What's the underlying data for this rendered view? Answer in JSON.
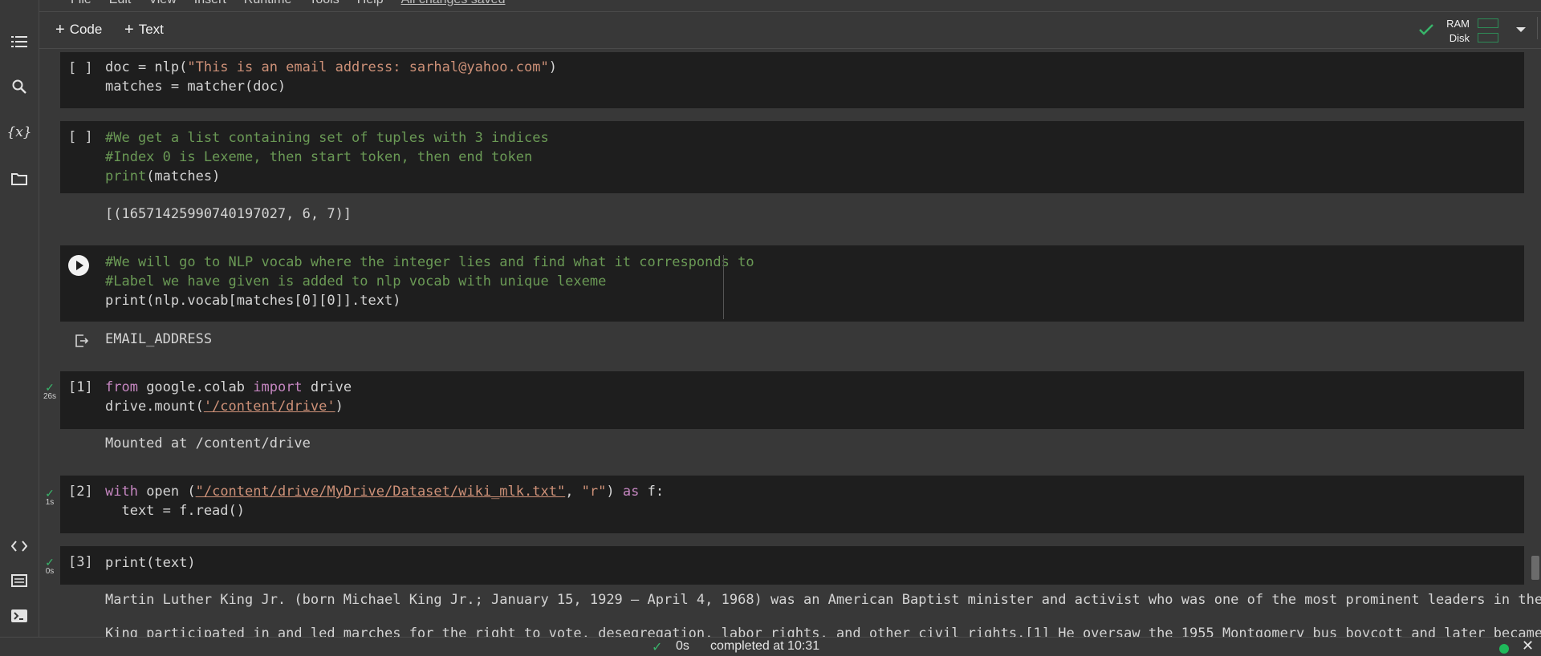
{
  "menu": {
    "items": [
      "File",
      "Edit",
      "View",
      "Insert",
      "Runtime",
      "Tools",
      "Help"
    ],
    "save_status": "All changes saved"
  },
  "toolbar": {
    "code_label": "Code",
    "text_label": "Text",
    "ram_label": "RAM",
    "disk_label": "Disk"
  },
  "icons": {
    "toc": "table-of-contents-icon",
    "search": "search-icon",
    "variables": "variables-icon",
    "files": "folder-icon",
    "snippets": "code-icon",
    "command_palette": "command-palette-icon",
    "terminal": "terminal-icon",
    "connected": "checkmark-icon",
    "dropdown": "chevron-down-icon",
    "collapse": "chevron-up-icon",
    "output_redirect": "output-icon",
    "close": "close-icon"
  },
  "colors": {
    "background": "#383838",
    "cell": "#1e1e1e",
    "comment": "#6a9955",
    "string": "#ce9178",
    "keyword": "#c586c0",
    "ok": "#38b46a"
  },
  "cells": [
    {
      "prompt": "[ ]",
      "lines": [
        "doc = nlp(",
        "\"This is an email address: sarhal@yahoo.com\"",
        ")",
        "matches = matcher(doc)"
      ]
    },
    {
      "prompt": "[ ]",
      "lines": [
        "#We get a list containing set of tuples with 3 indices",
        "#Index 0 is Lexeme, then start token, then end token",
        "print",
        "(matches)"
      ],
      "output": "[(16571425990740197027, 6, 7)]"
    },
    {
      "lines": [
        "#We will go to NLP vocab where the integer lies and find what it corresponds to",
        "#Label we have given is added to nlp vocab with unique lexeme",
        "print(nlp.vocab[matches[0][0]].text)"
      ],
      "output": "EMAIL_ADDRESS"
    },
    {
      "prompt": "[1]",
      "duration": "26s",
      "lines": [
        "from",
        " google.colab ",
        "import",
        " drive",
        "drive.mount(",
        "'/content/drive'",
        ")"
      ],
      "output": "Mounted at /content/drive"
    },
    {
      "prompt": "[2]",
      "duration": "1s",
      "lines": [
        "with",
        " open (",
        "\"/content/drive/MyDrive/Dataset/wiki_mlk.txt\"",
        ", ",
        "\"r\"",
        ") ",
        "as",
        " f:",
        "  text = f.read()"
      ]
    },
    {
      "prompt": "[3]",
      "duration": "0s",
      "lines": [
        "print(text)"
      ],
      "output": [
        "Martin Luther King Jr. (born Michael King Jr.; January 15, 1929 – April 4, 1968) was an American Baptist minister and activist who was one of the most prominent leaders in the civil ri",
        "King participated in and led marches for the right to vote, desegregation, labor rights, and other civil rights.[1] He oversaw the 1955 Montgomery bus boycott and later became the firs"
      ]
    }
  ],
  "status": {
    "duration": "0s",
    "completed": "completed at 10:31"
  }
}
